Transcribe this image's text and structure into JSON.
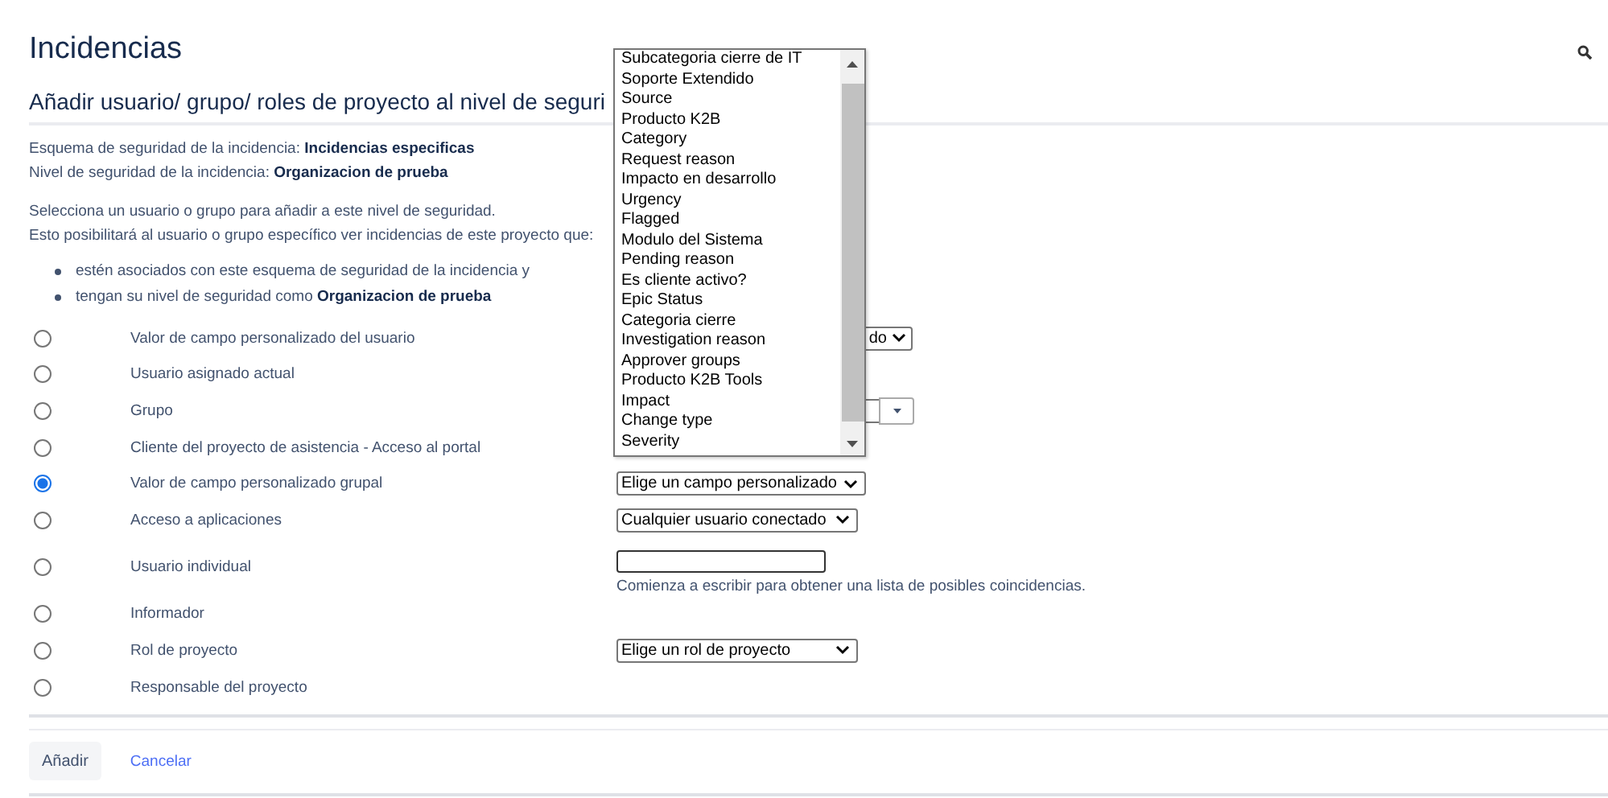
{
  "page_title": "Incidencias",
  "section_title": "Añadir usuario/ grupo/ roles de proyecto al nivel de seguri",
  "info": [
    {
      "label": "Esquema de seguridad de la incidencia: ",
      "value": "Incidencias especificas"
    },
    {
      "label": "Nivel de seguridad de la incidencia: ",
      "value": "Organizacion de prueba"
    }
  ],
  "intro": [
    "Selecciona un usuario o grupo para añadir a este nivel de seguridad.",
    "Esto posibilitará al usuario o grupo específico ver incidencias de este proyecto que:"
  ],
  "conditions": [
    "estén asociados con este esquema de seguridad de la incidencia y",
    "tengan su nivel de seguridad como **Organizacion de prueba**"
  ],
  "options": [
    {
      "label": "Valor de campo personalizado del usuario",
      "selected": false,
      "control": {
        "kind": "covered_select",
        "value": "do"
      }
    },
    {
      "label": "Usuario asignado actual",
      "selected": false
    },
    {
      "label": "Grupo",
      "selected": false,
      "control": {
        "kind": "picker"
      }
    },
    {
      "label": "Cliente del proyecto de asistencia - Acceso al portal",
      "selected": false
    },
    {
      "label": "Valor de campo personalizado grupal",
      "selected": true,
      "control": {
        "kind": "select",
        "value": "Elige un campo personalizado"
      }
    },
    {
      "label": "Acceso a aplicaciones",
      "selected": false,
      "control": {
        "kind": "select",
        "value": "Cualquier usuario conectado"
      }
    },
    {
      "label": "Usuario individual",
      "selected": false,
      "control": {
        "kind": "text",
        "hint": "Comienza a escribir para obtener una lista de posibles coincidencias."
      }
    },
    {
      "label": "Informador",
      "selected": false
    },
    {
      "label": "Rol de proyecto",
      "selected": false,
      "control": {
        "kind": "select",
        "value": "Elige un rol de proyecto"
      }
    },
    {
      "label": "Responsable del proyecto",
      "selected": false
    }
  ],
  "dropdown_options": [
    "Subcategoria cierre de IT",
    "Soporte Extendido",
    "Source",
    "Producto K2B",
    "Category",
    "Request reason",
    "Impacto en desarrollo",
    "Urgency",
    "Flagged",
    "Modulo del Sistema",
    "Pending reason",
    "Es cliente activo?",
    "Epic Status",
    "Categoria cierre",
    "Investigation reason",
    "Approver groups",
    "Producto K2B Tools",
    "Impact",
    "Change type",
    "Severity"
  ],
  "buttons": {
    "submit": "Añadir",
    "cancel": "Cancelar"
  }
}
